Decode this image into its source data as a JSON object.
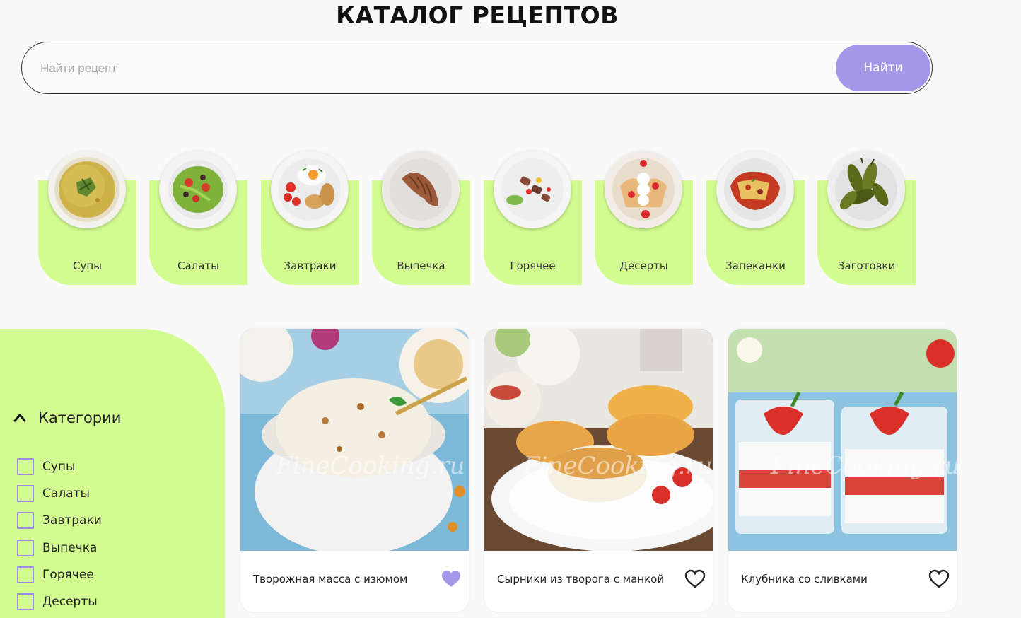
{
  "header": {
    "title": "КАТАЛОГ РЕЦЕПТОВ"
  },
  "search": {
    "placeholder": "Найти рецепт",
    "value": "",
    "button_label": "Найти"
  },
  "categories": [
    {
      "label": "Супы",
      "icon": "soup-plate-icon"
    },
    {
      "label": "Салаты",
      "icon": "salad-plate-icon"
    },
    {
      "label": "Завтраки",
      "icon": "breakfast-plate-icon"
    },
    {
      "label": "Выпечка",
      "icon": "croissant-plate-icon"
    },
    {
      "label": "Горячее",
      "icon": "hot-dish-plate-icon"
    },
    {
      "label": "Десерты",
      "icon": "dessert-plate-icon"
    },
    {
      "label": "Запеканки",
      "icon": "casserole-plate-icon"
    },
    {
      "label": "Заготовки",
      "icon": "pickles-plate-icon"
    }
  ],
  "filters": {
    "title": "Категории",
    "items": [
      {
        "label": "Супы",
        "checked": false
      },
      {
        "label": "Салаты",
        "checked": false
      },
      {
        "label": "Завтраки",
        "checked": false
      },
      {
        "label": "Выпечка",
        "checked": false
      },
      {
        "label": "Горячее",
        "checked": false
      },
      {
        "label": "Десерты",
        "checked": false
      }
    ]
  },
  "recipes": [
    {
      "title": "Творожная масса с изюмом",
      "favorite": true,
      "watermark": "FineCooking.ru"
    },
    {
      "title": "Сырники из творога с манкой",
      "favorite": false,
      "watermark": "FineCooking.ru"
    },
    {
      "title": "Клубника со сливками",
      "favorite": false,
      "watermark": "FineCooking.ru"
    }
  ],
  "colors": {
    "accent": "#a597e8",
    "panel": "#d3fc90",
    "favorite_active": "#a597e8"
  }
}
